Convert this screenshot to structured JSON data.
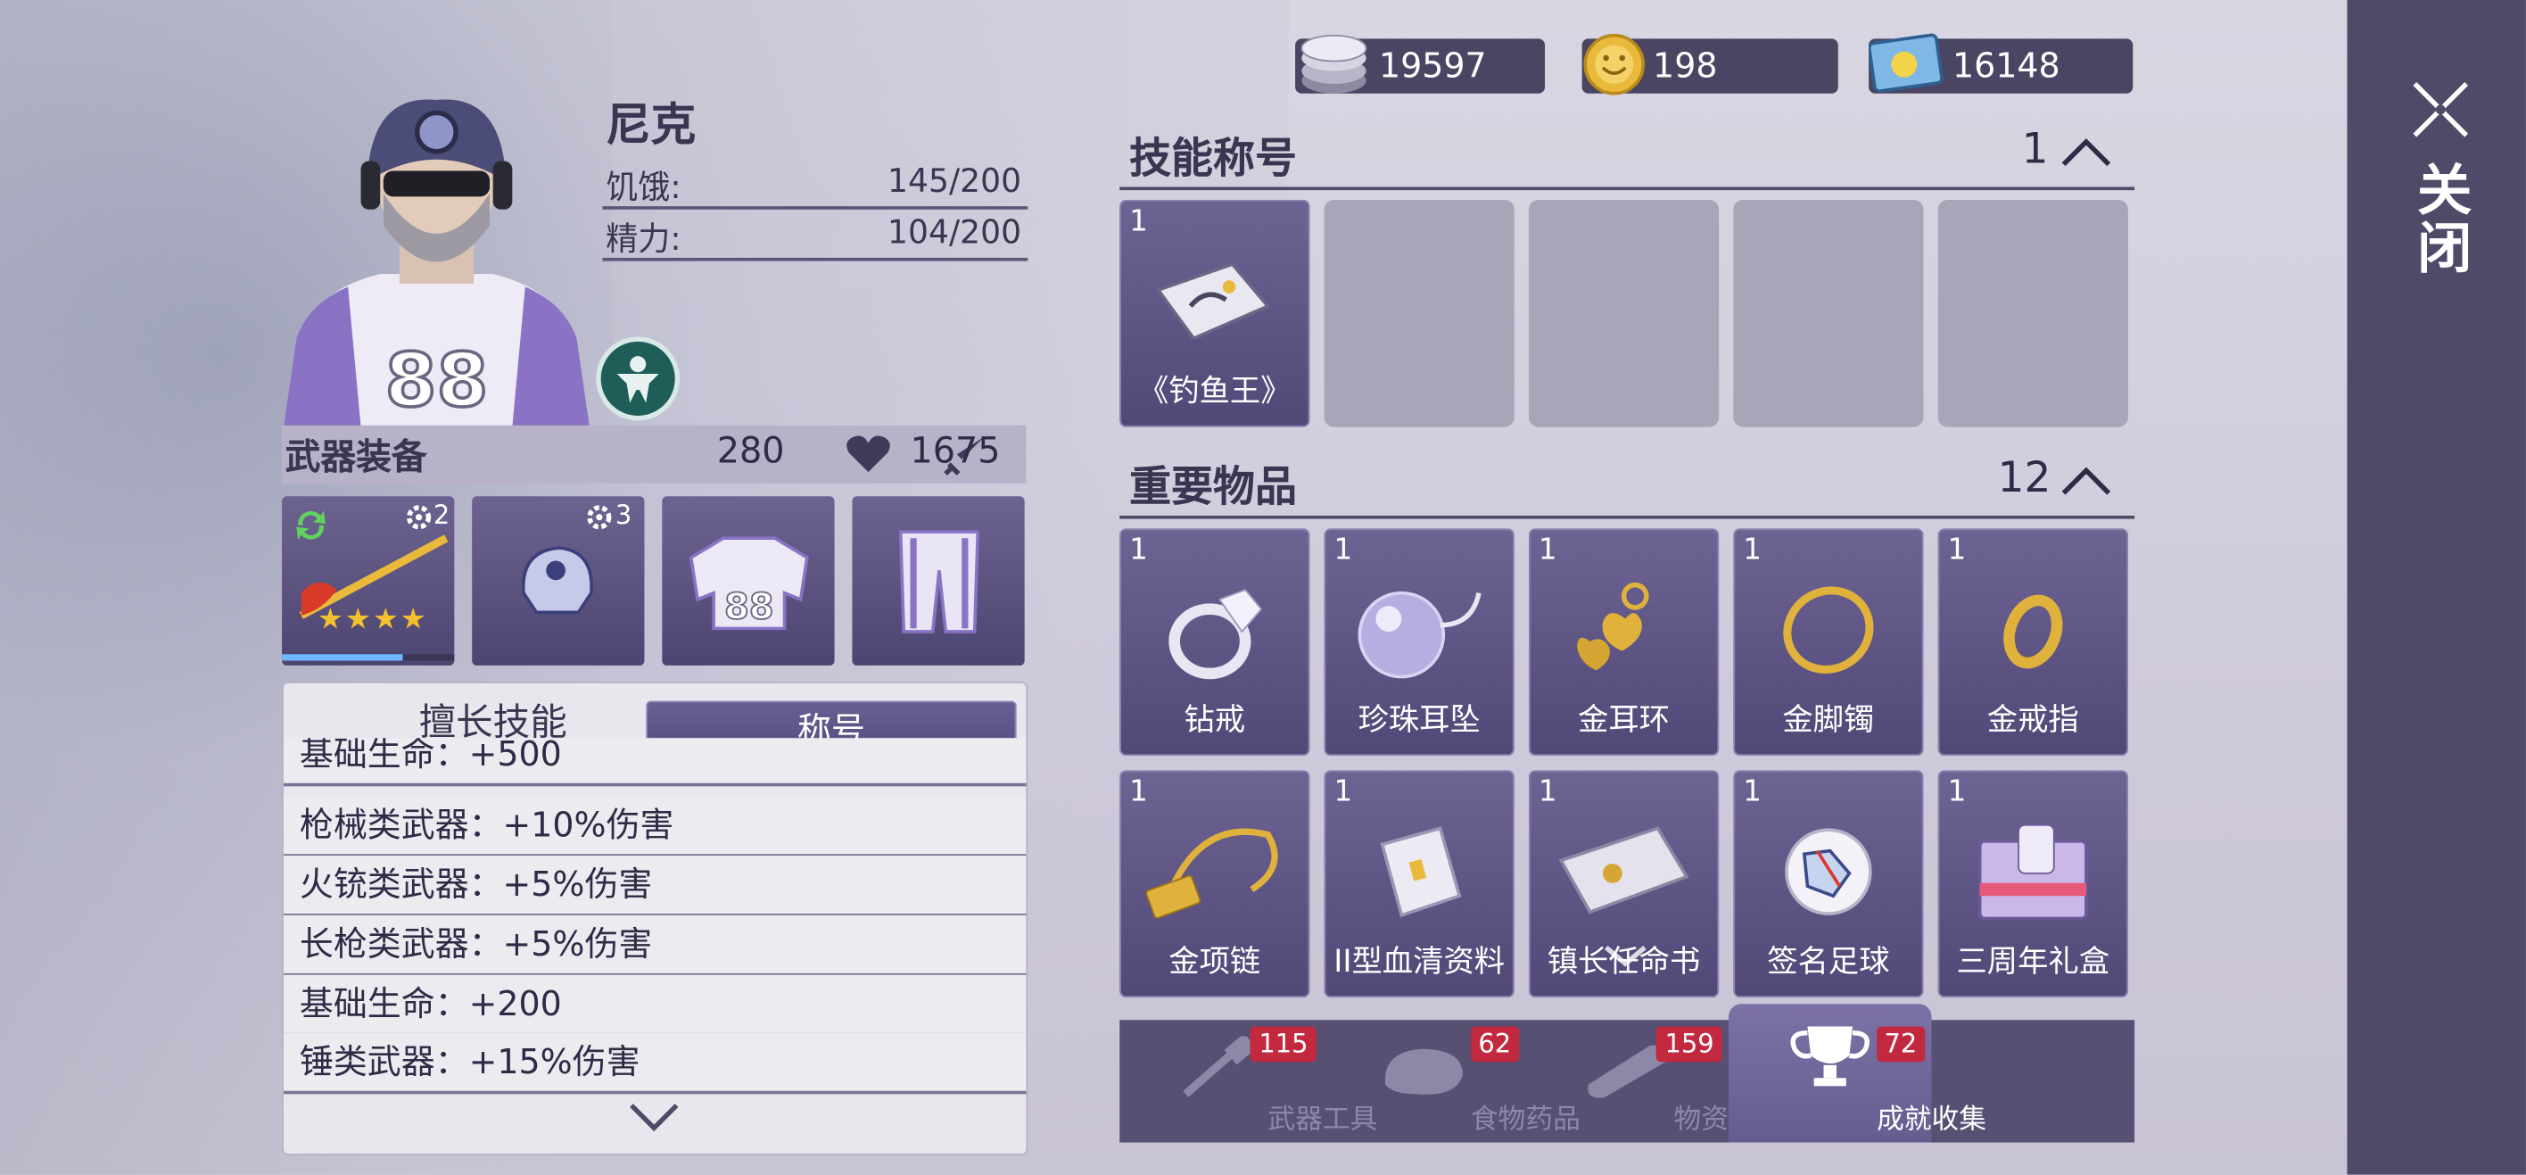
{
  "currencies": [
    {
      "icon": "silver-coin-stack-icon",
      "value": "19597"
    },
    {
      "icon": "gold-coin-icon",
      "value": "198"
    },
    {
      "icon": "ticket-icon",
      "value": "16148"
    }
  ],
  "close": {
    "label": "关闭"
  },
  "character": {
    "name": "尼克",
    "hunger_label": "饥饿:",
    "hunger_value": "145/200",
    "energy_label": "精力:",
    "energy_value": "104/200",
    "jersey_number": "88"
  },
  "weapon": {
    "title": "武器装备",
    "attack": "280",
    "health": "1675",
    "slots": [
      {
        "name": "weapon",
        "level": "2",
        "stars": 4
      },
      {
        "name": "helmet",
        "level": "3"
      },
      {
        "name": "jersey"
      },
      {
        "name": "pants"
      }
    ]
  },
  "skills_panel": {
    "tab_skills": "擅长技能",
    "tab_titles": "称号",
    "rows": [
      "基础生命：+500",
      "枪械类武器：+10%伤害",
      "火铳类武器：+5%伤害",
      "长枪类武器：+5%伤害",
      "基础生命：+200",
      "锤类武器：+15%伤害"
    ]
  },
  "skill_title_section": {
    "title": "技能称号",
    "count": "1",
    "items": [
      {
        "qty": "1",
        "name": "《钓鱼王》"
      }
    ]
  },
  "important_items": {
    "title": "重要物品",
    "count": "12",
    "items": [
      {
        "qty": "1",
        "name": "钻戒"
      },
      {
        "qty": "1",
        "name": "珍珠耳坠"
      },
      {
        "qty": "1",
        "name": "金耳环"
      },
      {
        "qty": "1",
        "name": "金脚镯"
      },
      {
        "qty": "1",
        "name": "金戒指"
      },
      {
        "qty": "1",
        "name": "金项链"
      },
      {
        "qty": "1",
        "name": "II型血清资料"
      },
      {
        "qty": "1",
        "name": "镇长任命书"
      },
      {
        "qty": "1",
        "name": "签名足球"
      },
      {
        "qty": "1",
        "name": "三周年礼盒"
      }
    ]
  },
  "bottom_nav": [
    {
      "label": "武器工具",
      "count": "115"
    },
    {
      "label": "食物药品",
      "count": "62"
    },
    {
      "label": "物资材料",
      "count": "159"
    },
    {
      "label": "成就收集",
      "count": "72",
      "active": true
    }
  ],
  "colors": {
    "sidebar": "#4f4a68",
    "item_bg": "#5e5585",
    "badge_red": "#c2293f",
    "gold": "#e8b93a"
  }
}
